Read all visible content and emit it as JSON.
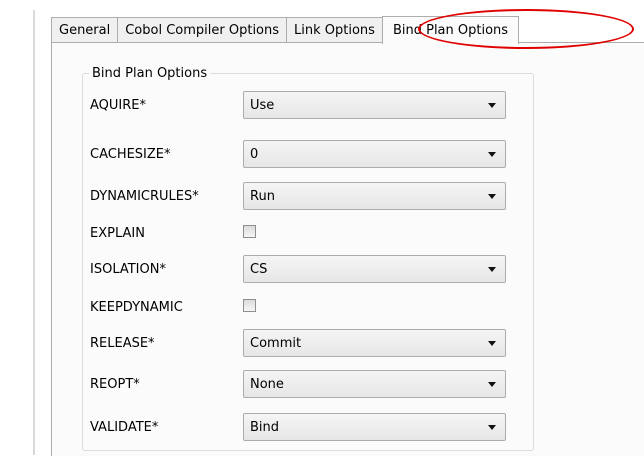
{
  "tabs": [
    {
      "label": "General"
    },
    {
      "label": "Cobol Compiler Options"
    },
    {
      "label": "Link Options"
    },
    {
      "label": "Bind Plan Options",
      "active": true
    }
  ],
  "group": {
    "title": "Bind Plan Options",
    "rows": [
      {
        "label": "AQUIRE*",
        "type": "select",
        "value": "Use"
      },
      {
        "label": "CACHESIZE*",
        "type": "select",
        "value": "0"
      },
      {
        "label": "DYNAMICRULES*",
        "type": "select",
        "value": "Run"
      },
      {
        "label": "EXPLAIN",
        "type": "checkbox",
        "checked": false
      },
      {
        "label": "ISOLATION*",
        "type": "select",
        "value": "CS"
      },
      {
        "label": "KEEPDYNAMIC",
        "type": "checkbox",
        "checked": false
      },
      {
        "label": "RELEASE*",
        "type": "select",
        "value": "Commit"
      },
      {
        "label": "REOPT*",
        "type": "select",
        "value": "None"
      },
      {
        "label": "VALIDATE*",
        "type": "select",
        "value": "Bind"
      }
    ]
  },
  "icons": {
    "dropdown": "chevron-down-icon",
    "checkbox": "checkbox-icon"
  },
  "colors": {
    "highlight_ellipse": "#e00000",
    "panel_background": "#fbfbfb"
  }
}
